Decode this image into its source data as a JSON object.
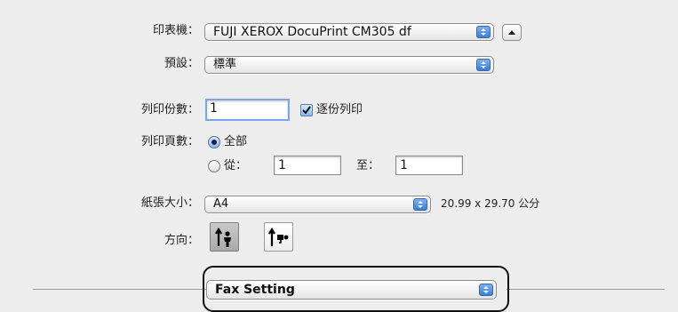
{
  "printer": {
    "label": "印表機：",
    "value": "FUJI XEROX DocuPrint CM305 df"
  },
  "presets": {
    "label": "預設：",
    "value": "標準"
  },
  "copies": {
    "label": "列印份數：",
    "value": "1",
    "collate_label": "逐份列印",
    "collate_checked": true
  },
  "pages": {
    "label": "列印頁數：",
    "all_label": "全部",
    "from_label": "從：",
    "from_value": "1",
    "to_label": "至：",
    "to_value": "1",
    "selected": "all"
  },
  "paper_size": {
    "label": "紙張大小：",
    "value": "A4",
    "dimensions": "20.99 x 29.70 公分"
  },
  "orientation": {
    "label": "方向：",
    "selected": "portrait"
  },
  "section_popup": {
    "value": "Fax Setting"
  },
  "colors": {
    "accent": "#3b7fd6",
    "background": "#ededed"
  }
}
